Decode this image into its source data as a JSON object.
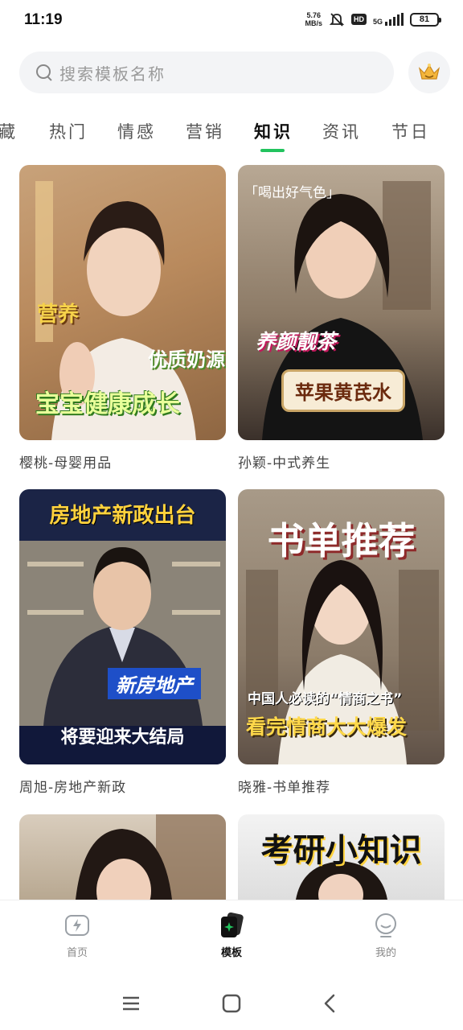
{
  "status_bar": {
    "time": "11:19",
    "net_speed_value": "5.76",
    "net_speed_unit": "MB/s",
    "hd_badge": "HD",
    "network": "5G",
    "battery": "81"
  },
  "search": {
    "placeholder": "搜索模板名称"
  },
  "tabs": {
    "items": [
      "藏",
      "热门",
      "情感",
      "营销",
      "知识",
      "资讯",
      "节日"
    ],
    "active": "知识"
  },
  "cards": [
    {
      "title": "樱桃-母婴用品",
      "overlays": [
        "营养",
        "优质奶源",
        "宝宝健康成长"
      ]
    },
    {
      "title": "孙颖-中式养生",
      "overlays": [
        "「喝出好气色」",
        "养颜靓茶",
        "苹果黄芪水"
      ]
    },
    {
      "title": "周旭-房地产新政",
      "overlays": [
        "房地产新政出台",
        "新房地产",
        "将要迎来大结局"
      ]
    },
    {
      "title": "晓雅-书单推荐",
      "overlays": [
        "书单推荐",
        "中国人必读的“情商之书”",
        "看完情商大大爆发"
      ]
    },
    {
      "title": "",
      "overlays": []
    },
    {
      "title": "",
      "overlays": [
        "考研小知识"
      ]
    }
  ],
  "bottom_nav": {
    "items": [
      {
        "label": "首页",
        "icon": "lightning-icon"
      },
      {
        "label": "模板",
        "icon": "template-cards-icon"
      },
      {
        "label": "我的",
        "icon": "smile-face-icon"
      }
    ],
    "active": "模板"
  },
  "colors": {
    "accent": "#22c35e"
  }
}
